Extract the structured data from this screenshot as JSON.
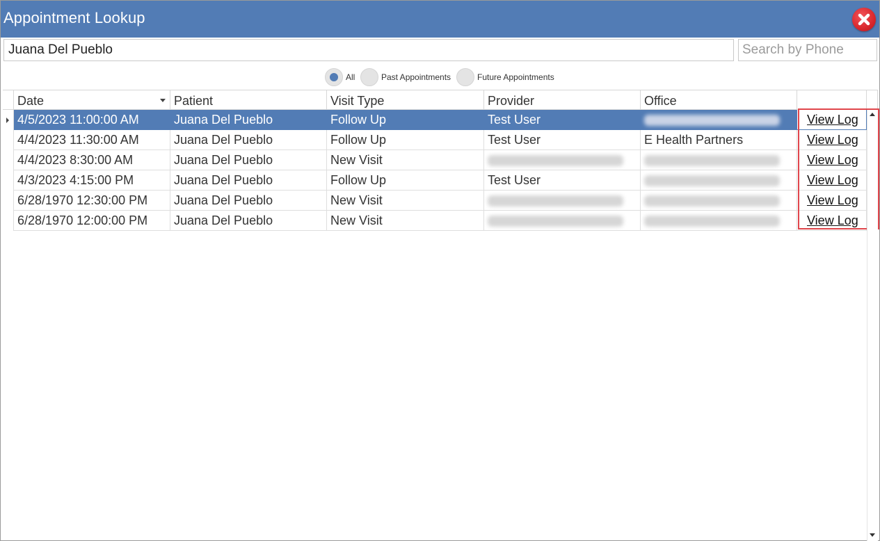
{
  "window": {
    "title": "Appointment Lookup"
  },
  "search": {
    "name_value": "Juana Del Pueblo",
    "phone_placeholder": "Search by Phone"
  },
  "filter": {
    "options": [
      {
        "label": "All",
        "selected": true
      },
      {
        "label": "Past Appointments",
        "selected": false
      },
      {
        "label": "Future Appointments",
        "selected": false
      }
    ]
  },
  "grid": {
    "columns": [
      "Date",
      "Patient",
      "Visit Type",
      "Provider",
      "Office",
      ""
    ],
    "rows": [
      {
        "date": "4/5/2023 11:00:00 AM",
        "patient": "Juana Del Pueblo",
        "visit_type": "Follow Up",
        "provider": "Test User",
        "office": "",
        "office_redacted": true,
        "provider_redacted": false,
        "action": "View Log",
        "selected": true
      },
      {
        "date": "4/4/2023 11:30:00 AM",
        "patient": "Juana Del Pueblo",
        "visit_type": "Follow Up",
        "provider": "Test User",
        "office": "E Health Partners",
        "office_redacted": false,
        "provider_redacted": false,
        "action": "View Log",
        "selected": false
      },
      {
        "date": "4/4/2023 8:30:00 AM",
        "patient": "Juana Del Pueblo",
        "visit_type": "New Visit",
        "provider": "",
        "office": "",
        "office_redacted": true,
        "provider_redacted": true,
        "action": "View Log",
        "selected": false
      },
      {
        "date": "4/3/2023 4:15:00 PM",
        "patient": "Juana Del Pueblo",
        "visit_type": "Follow Up",
        "provider": "Test User",
        "office": "",
        "office_redacted": true,
        "provider_redacted": false,
        "action": "View Log",
        "selected": false
      },
      {
        "date": "6/28/1970 12:30:00 PM",
        "patient": "Juana Del Pueblo",
        "visit_type": "New Visit",
        "provider": "",
        "office": "",
        "office_redacted": true,
        "provider_redacted": true,
        "action": "View Log",
        "selected": false
      },
      {
        "date": "6/28/1970 12:00:00 PM",
        "patient": "Juana Del Pueblo",
        "visit_type": "New Visit",
        "provider": "",
        "office": "",
        "office_redacted": true,
        "provider_redacted": true,
        "action": "View Log",
        "selected": false
      }
    ]
  },
  "colors": {
    "accent": "#527cb5",
    "highlight": "#e0454b",
    "close": "#d9272d"
  }
}
